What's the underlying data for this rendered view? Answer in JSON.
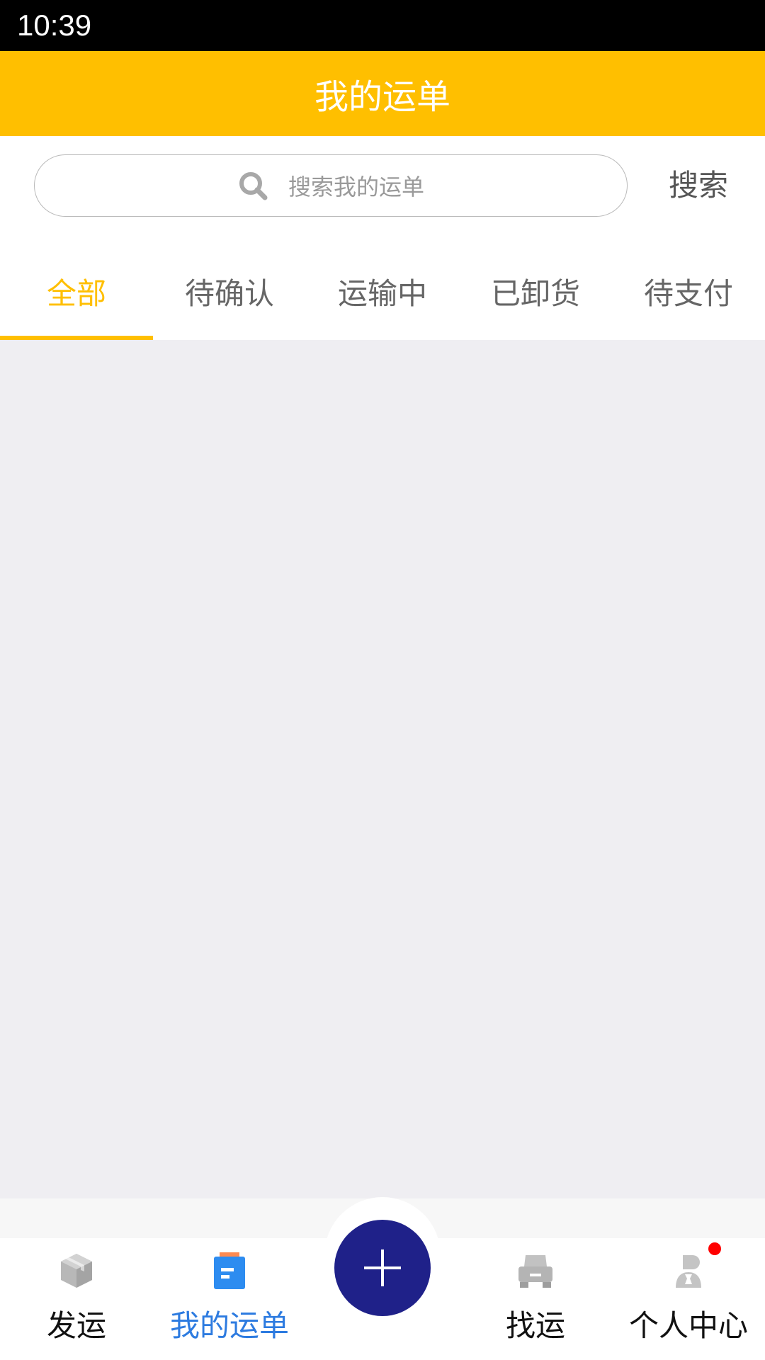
{
  "status_bar": {
    "time": "10:39"
  },
  "header": {
    "title": "我的运单"
  },
  "search": {
    "placeholder": "搜索我的运单",
    "button_label": "搜索"
  },
  "tabs": [
    {
      "label": "全部",
      "active": true
    },
    {
      "label": "待确认",
      "active": false
    },
    {
      "label": "运输中",
      "active": false
    },
    {
      "label": "已卸货",
      "active": false
    },
    {
      "label": "待支付",
      "active": false
    }
  ],
  "bottom_nav": {
    "items": [
      {
        "label": "发运",
        "icon": "box-icon",
        "active": false
      },
      {
        "label": "我的运单",
        "icon": "document-icon",
        "active": true
      },
      {
        "label": "找运",
        "icon": "truck-icon",
        "active": false
      },
      {
        "label": "个人中心",
        "icon": "user-icon",
        "active": false,
        "badge": true
      }
    ],
    "center_button_icon": "plus-icon"
  },
  "colors": {
    "accent": "#FFBF00",
    "active_nav": "#2d7be0",
    "fab": "#1f2189",
    "content_bg": "#efeef2"
  }
}
